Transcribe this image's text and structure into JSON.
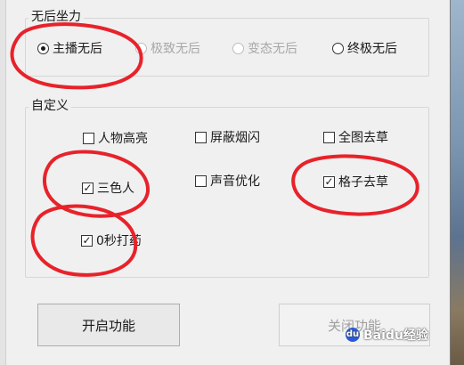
{
  "groups": {
    "aim": {
      "title": "无后坐力",
      "options": [
        {
          "label": "主播无后",
          "selected": true,
          "enabled": true
        },
        {
          "label": "极致无后",
          "selected": false,
          "enabled": false
        },
        {
          "label": "变态无后",
          "selected": false,
          "enabled": false
        },
        {
          "label": "终极无后",
          "selected": false,
          "enabled": true
        }
      ]
    },
    "custom": {
      "title": "自定义",
      "options": [
        {
          "label": "人物高亮",
          "checked": false
        },
        {
          "label": "屏蔽烟闪",
          "checked": false
        },
        {
          "label": "全图去草",
          "checked": false
        },
        {
          "label": "三色人",
          "checked": true
        },
        {
          "label": "声音优化",
          "checked": false
        },
        {
          "label": "格子去草",
          "checked": true
        },
        {
          "label": "0秒打药",
          "checked": true
        }
      ]
    }
  },
  "buttons": {
    "start": "开启功能",
    "stop": "关闭功能"
  },
  "watermark": {
    "text": "Baidu经验"
  },
  "colors": {
    "annotation": "#e8222a",
    "window_bg": "#f0f0f0"
  },
  "icons": {
    "check": "✓",
    "paw": "du"
  }
}
